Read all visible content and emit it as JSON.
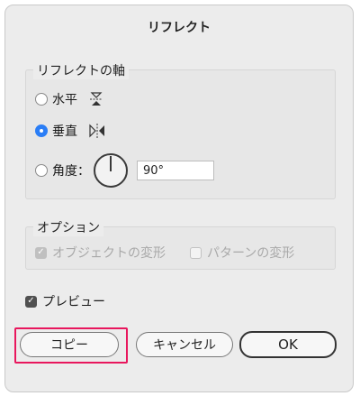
{
  "dialog": {
    "title": "リフレクト"
  },
  "axis_group": {
    "legend": "リフレクトの軸",
    "options": [
      {
        "label": "水平",
        "selected": false,
        "icon": "reflect-horizontal-icon"
      },
      {
        "label": "垂直",
        "selected": true,
        "icon": "reflect-vertical-icon"
      },
      {
        "label": "角度：",
        "selected": false,
        "icon": "angle-dial-icon"
      }
    ],
    "angle_value": "90°"
  },
  "options_group": {
    "legend": "オプション",
    "transform_objects": {
      "label": "オブジェクトの変形",
      "checked": true,
      "enabled": false
    },
    "transform_patterns": {
      "label": "パターンの変形",
      "checked": false,
      "enabled": false
    }
  },
  "preview": {
    "label": "プレビュー",
    "checked": true
  },
  "buttons": {
    "copy": "コピー",
    "cancel": "キャンセル",
    "ok": "OK"
  },
  "colors": {
    "accent": "#2b7ef6",
    "highlight": "#e8175d"
  }
}
